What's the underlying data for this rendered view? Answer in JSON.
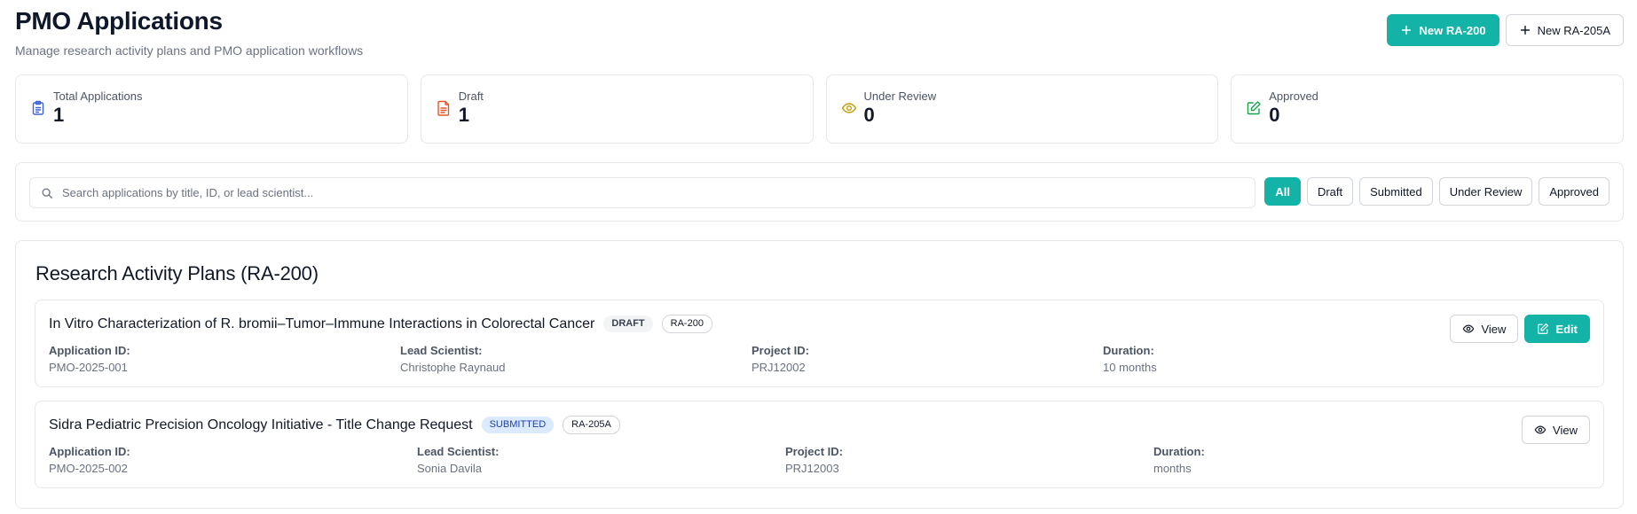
{
  "header": {
    "title": "PMO Applications",
    "subtitle": "Manage research activity plans and PMO application workflows",
    "new_ra200_label": "New RA-200",
    "new_ra205a_label": "New RA-205A"
  },
  "stats": [
    {
      "label": "Total Applications",
      "value": "1",
      "icon": "clipboard-icon",
      "color": "#3b63d6"
    },
    {
      "label": "Draft",
      "value": "1",
      "icon": "file-text-icon",
      "color": "#e4572e"
    },
    {
      "label": "Under Review",
      "value": "0",
      "icon": "eye-icon",
      "color": "#c99a06"
    },
    {
      "label": "Approved",
      "value": "0",
      "icon": "edit-check-icon",
      "color": "#16a34a"
    }
  ],
  "search": {
    "placeholder": "Search applications by title, ID, or lead scientist..."
  },
  "filters": [
    "All",
    "Draft",
    "Submitted",
    "Under Review",
    "Approved"
  ],
  "active_filter": "All",
  "section": {
    "title": "Research Activity Plans (RA-200)"
  },
  "applications": [
    {
      "title": "In Vitro Characterization of R. bromii–Tumor–Immune Interactions in Colorectal Cancer",
      "status": "DRAFT",
      "form": "RA-200",
      "fields": [
        {
          "label": "Application ID:",
          "value": "PMO-2025-001"
        },
        {
          "label": "Lead Scientist:",
          "value": "Christophe Raynaud"
        },
        {
          "label": "Project ID:",
          "value": "PRJ12002"
        },
        {
          "label": "Duration:",
          "value": "10 months"
        }
      ],
      "view_label": "View",
      "edit_label": "Edit"
    },
    {
      "title": "Sidra Pediatric Precision Oncology Initiative - Title Change Request",
      "status": "SUBMITTED",
      "form": "RA-205A",
      "fields": [
        {
          "label": "Application ID:",
          "value": "PMO-2025-002"
        },
        {
          "label": "Lead Scientist:",
          "value": "Sonia Davila"
        },
        {
          "label": "Project ID:",
          "value": "PRJ12003"
        },
        {
          "label": "Duration:",
          "value": "months"
        }
      ],
      "view_label": "View"
    }
  ],
  "colors": {
    "accent": "#14b3a8",
    "border": "#e5e7eb"
  }
}
